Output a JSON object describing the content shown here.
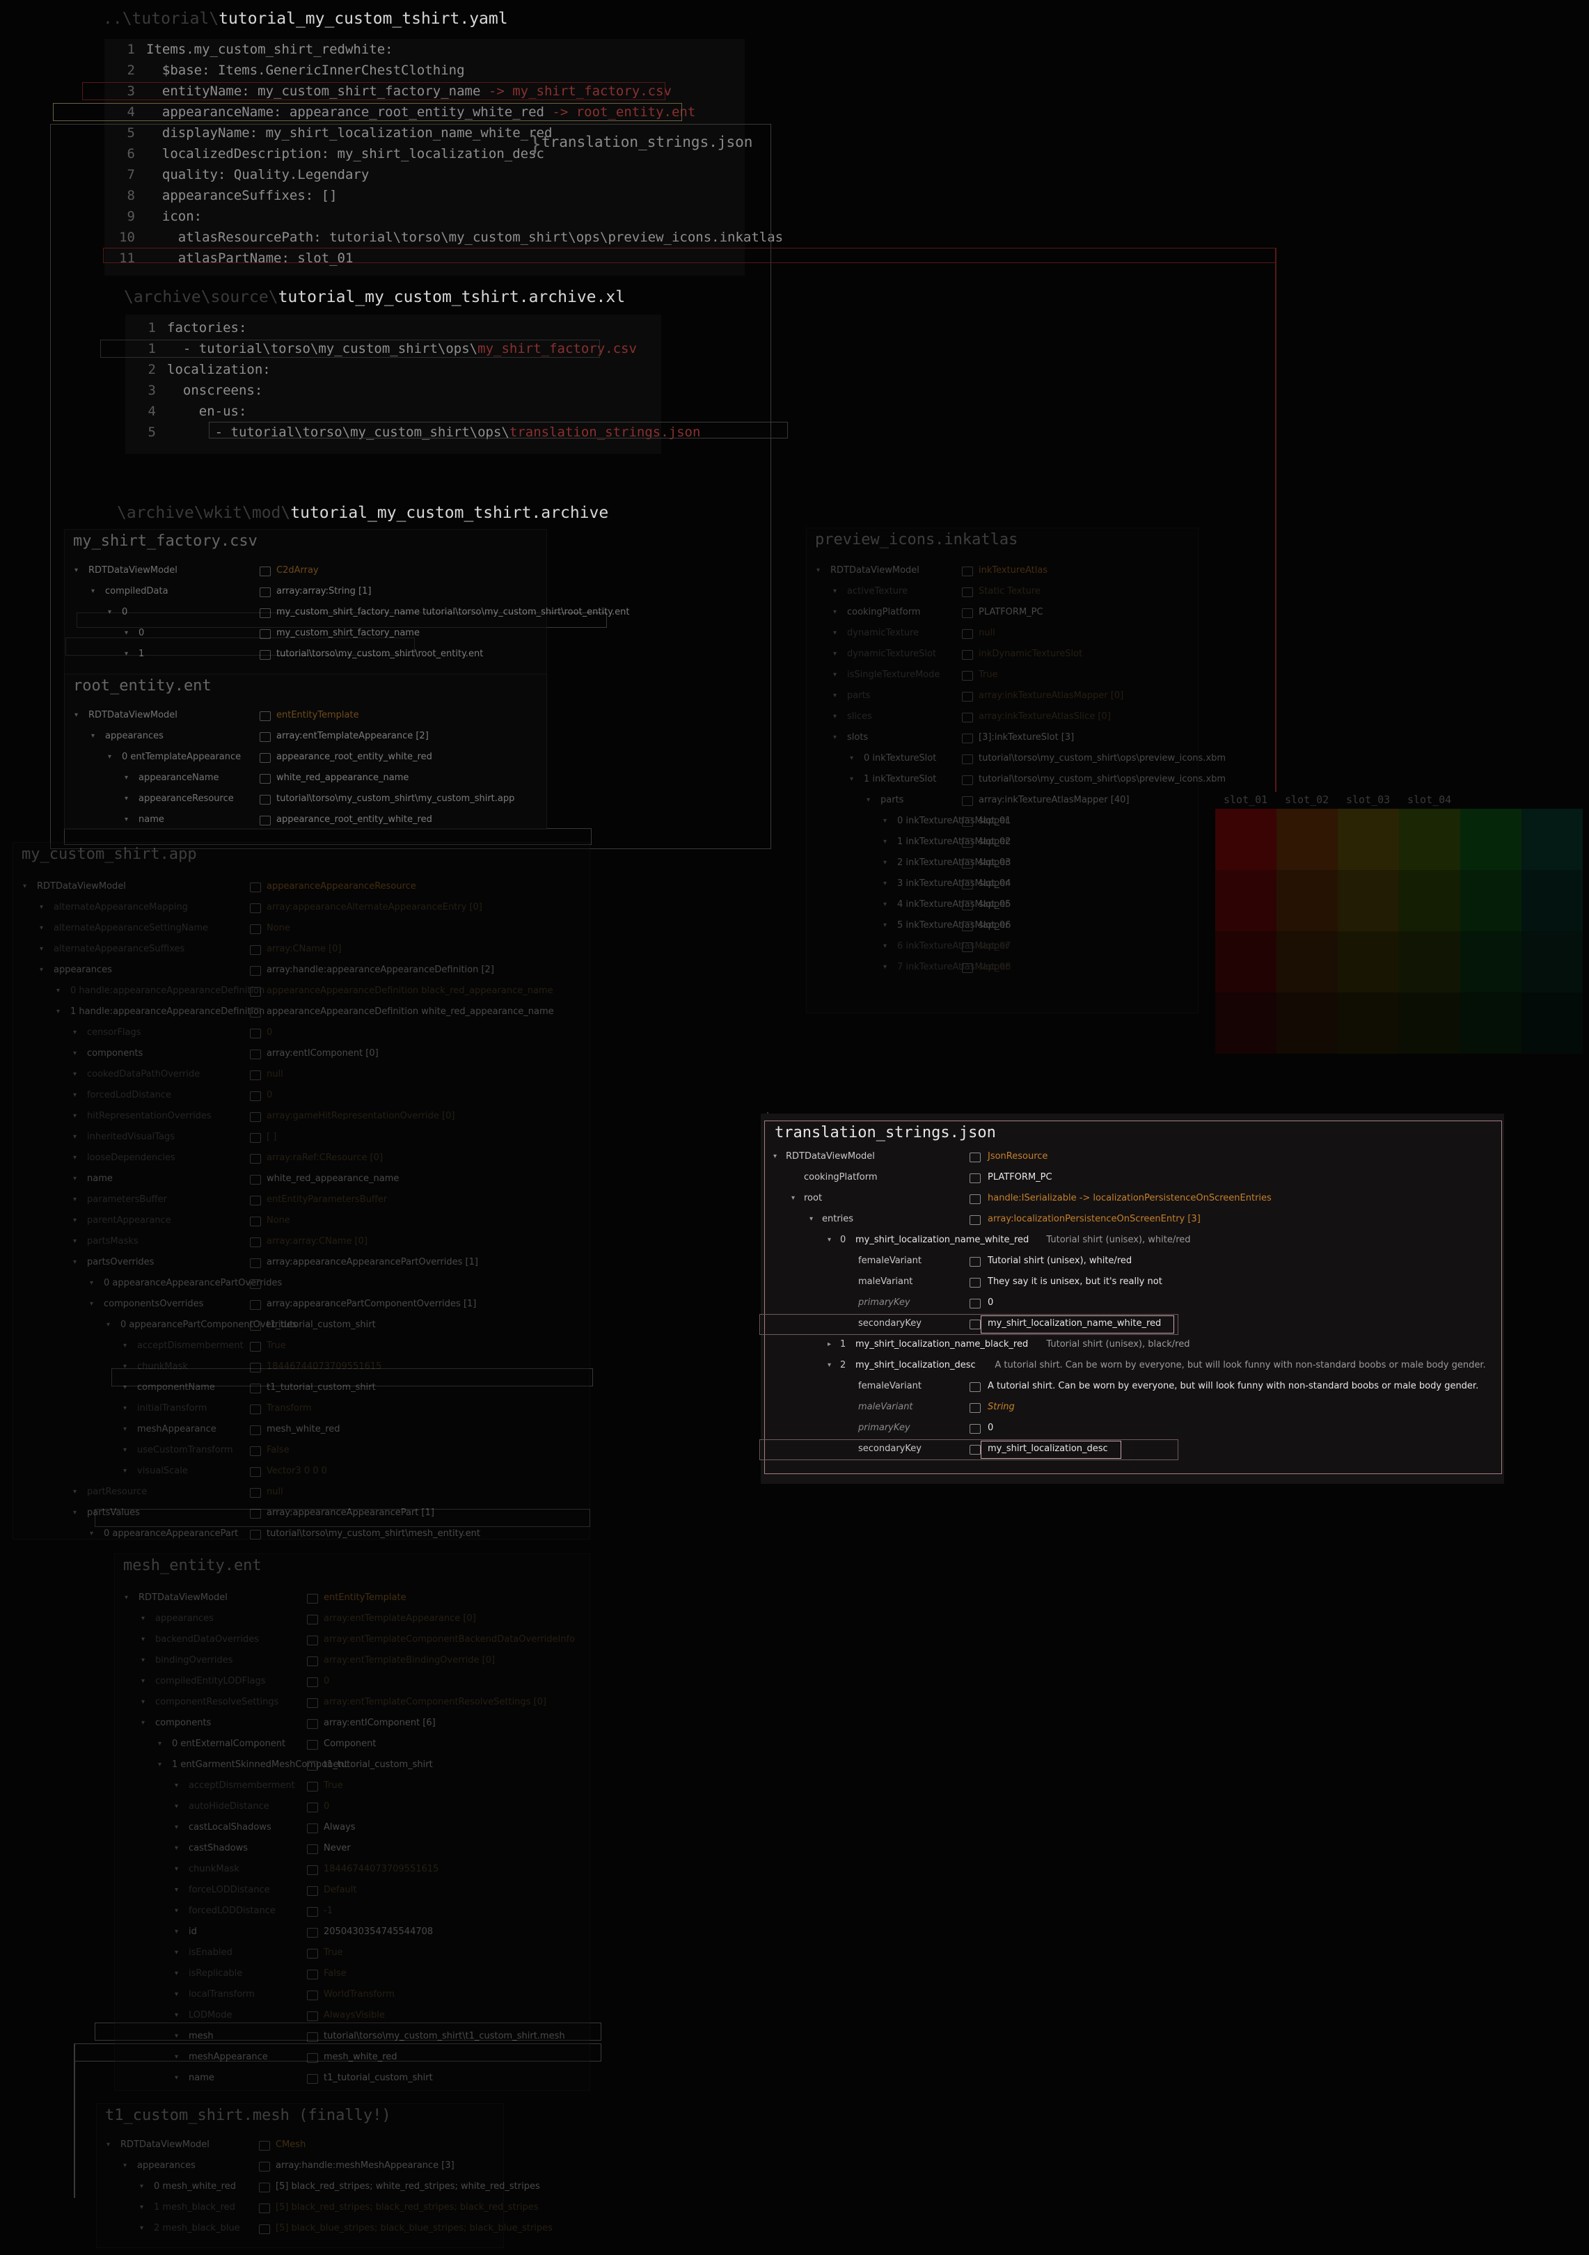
{
  "yaml": {
    "path": "..\\tutorial\\",
    "title": "tutorial_my_custom_tshirt.yaml",
    "lines": [
      {
        "n": "1",
        "t": "Items.my_custom_shirt_redwhite:"
      },
      {
        "n": "2",
        "t": "  $base: Items.GenericInnerChestClothing"
      },
      {
        "n": "3",
        "t": "  entityName: my_custom_shirt_factory_name ",
        "h": "-> my_shirt_factory.csv"
      },
      {
        "n": "4",
        "t": "  appearanceName: appearance_root_entity_white_red ",
        "h": "-> root_entity.ent"
      },
      {
        "n": "5",
        "t": "  displayName: my_shirt_localization_name_white_red"
      },
      {
        "n": "6",
        "t": "  localizedDescription: my_shirt_localization_desc"
      },
      {
        "n": "7",
        "t": "  quality: Quality.Legendary"
      },
      {
        "n": "8",
        "t": "  appearanceSuffixes: []"
      },
      {
        "n": "9",
        "t": "  icon:"
      },
      {
        "n": "10",
        "t": "    atlasResourcePath: tutorial\\torso\\my_custom_shirt\\ops\\preview_icons.inkatlas"
      },
      {
        "n": "11",
        "t": "    atlasPartName: slot_01"
      }
    ],
    "bracket_label": "translation_strings.json"
  },
  "xl": {
    "path": "\\archive\\source\\",
    "title": "tutorial_my_custom_tshirt.archive.xl",
    "lines": [
      {
        "n": "1",
        "t": "factories:"
      },
      {
        "n": "1",
        "t": "  - tutorial\\torso\\my_custom_shirt\\ops\\",
        "h": "my_shirt_factory.csv"
      },
      {
        "n": "2",
        "t": "localization:"
      },
      {
        "n": "3",
        "t": "  onscreens:"
      },
      {
        "n": "4",
        "t": "    en-us:"
      },
      {
        "n": "5",
        "t": "      - tutorial\\torso\\my_custom_shirt\\ops\\",
        "h": "translation_strings.json"
      }
    ]
  },
  "archive": {
    "path": "\\archive\\wkit\\mod\\",
    "title": "tutorial_my_custom_tshirt.archive"
  },
  "factory": {
    "title": "my_shirt_factory.csv",
    "rows": [
      {
        "k": "RDTDataViewModel",
        "v": "C2dArray"
      },
      {
        "k": "compiledData",
        "v": "array:array:String [1]"
      },
      {
        "k": "0",
        "v": "my_custom_shirt_factory_name   tutorial\\torso\\my_custom_shirt\\root_entity.ent"
      },
      {
        "k": "0",
        "v": "my_custom_shirt_factory_name"
      },
      {
        "k": "1",
        "v": "tutorial\\torso\\my_custom_shirt\\root_entity.ent"
      }
    ]
  },
  "root": {
    "title": "root_entity.ent",
    "rows": [
      {
        "k": "RDTDataViewModel",
        "v": "entEntityTemplate"
      },
      {
        "k": "appearances",
        "v": "array:entTemplateAppearance [2]"
      },
      {
        "k": "0  entTemplateAppearance",
        "v": "appearance_root_entity_white_red"
      },
      {
        "k": "appearanceName",
        "v": "white_red_appearance_name"
      },
      {
        "k": "appearanceResource",
        "v": "tutorial\\torso\\my_custom_shirt\\my_custom_shirt.app"
      },
      {
        "k": "name",
        "v": "appearance_root_entity_white_red"
      }
    ]
  },
  "app": {
    "title": "my_custom_shirt.app",
    "rows": [
      {
        "k": "RDTDataViewModel",
        "v": "appearanceAppearanceResource"
      },
      {
        "k": "alternateAppearanceMapping",
        "v": "array:appearanceAlternateAppearanceEntry [0]"
      },
      {
        "k": "alternateAppearanceSettingName",
        "v": "None"
      },
      {
        "k": "alternateAppearanceSuffixes",
        "v": "array:CName [0]"
      },
      {
        "k": "appearances",
        "v": "array:handle:appearanceAppearanceDefinition [2]"
      },
      {
        "k": "0  handle:appearanceAppearanceDefinition",
        "v": "appearanceAppearanceDefinition  black_red_appearance_name"
      },
      {
        "k": "1  handle:appearanceAppearanceDefinition",
        "v": "appearanceAppearanceDefinition  white_red_appearance_name"
      },
      {
        "k": "censorFlags",
        "v": "0"
      },
      {
        "k": "components",
        "v": "array:entIComponent [0]"
      },
      {
        "k": "cookedDataPathOverride",
        "v": "null"
      },
      {
        "k": "forcedLodDistance",
        "v": "0"
      },
      {
        "k": "hitRepresentationOverrides",
        "v": "array:gameHitRepresentationOverride [0]"
      },
      {
        "k": "inheritedVisualTags",
        "v": "[ ]"
      },
      {
        "k": "looseDependencies",
        "v": "array:raRef:CResource [0]"
      },
      {
        "k": "name",
        "v": "white_red_appearance_name"
      },
      {
        "k": "parametersBuffer",
        "v": "entEntityParametersBuffer"
      },
      {
        "k": "parentAppearance",
        "v": "None"
      },
      {
        "k": "partsMasks",
        "v": "array:array:CName [0]"
      },
      {
        "k": "partsOverrides",
        "v": "array:appearanceAppearancePartOverrides [1]"
      },
      {
        "k": "0  appearanceAppearancePartOverrides",
        "v": ""
      },
      {
        "k": "componentsOverrides",
        "v": "array:appearancePartComponentOverrides [1]"
      },
      {
        "k": "0  appearancePartComponentOverrides",
        "v": "t1_tutorial_custom_shirt"
      },
      {
        "k": "acceptDismemberment",
        "v": "True"
      },
      {
        "k": "chunkMask",
        "v": "18446744073709551615"
      },
      {
        "k": "componentName",
        "v": "t1_tutorial_custom_shirt"
      },
      {
        "k": "initialTransform",
        "v": "Transform"
      },
      {
        "k": "meshAppearance",
        "v": "mesh_white_red"
      },
      {
        "k": "useCustomTransform",
        "v": "False"
      },
      {
        "k": "visualScale",
        "v": "Vector3 0 0 0"
      },
      {
        "k": "partResource",
        "v": "null"
      },
      {
        "k": "partsValues",
        "v": "array:appearanceAppearancePart [1]"
      },
      {
        "k": "0  appearanceAppearancePart",
        "v": "tutorial\\torso\\my_custom_shirt\\mesh_entity.ent"
      }
    ]
  },
  "mesh_entity": {
    "title": "mesh_entity.ent",
    "rows": [
      {
        "k": "RDTDataViewModel",
        "v": "entEntityTemplate"
      },
      {
        "k": "appearances",
        "v": "array:entTemplateAppearance [0]"
      },
      {
        "k": "backendDataOverrides",
        "v": "array:entTemplateComponentBackendDataOverrideInfo"
      },
      {
        "k": "bindingOverrides",
        "v": "array:entTemplateBindingOverride [0]"
      },
      {
        "k": "compiledEntityLODFlags",
        "v": "0"
      },
      {
        "k": "componentResolveSettings",
        "v": "array:entTemplateComponentResolveSettings [0]"
      },
      {
        "k": "components",
        "v": "array:entIComponent [6]"
      },
      {
        "k": "0  entExternalComponent",
        "v": "Component"
      },
      {
        "k": "1  entGarmentSkinnedMeshComponent",
        "v": "t1_tutorial_custom_shirt"
      },
      {
        "k": "acceptDismemberment",
        "v": "True"
      },
      {
        "k": "autoHideDistance",
        "v": "0"
      },
      {
        "k": "castLocalShadows",
        "v": "Always"
      },
      {
        "k": "castShadows",
        "v": "Never"
      },
      {
        "k": "chunkMask",
        "v": "18446744073709551615"
      },
      {
        "k": "forceLODDistance",
        "v": "Default"
      },
      {
        "k": "forcedLODDistance",
        "v": "-1"
      },
      {
        "k": "id",
        "v": "2050430354745544708"
      },
      {
        "k": "isEnabled",
        "v": "True"
      },
      {
        "k": "isReplicable",
        "v": "False"
      },
      {
        "k": "localTransform",
        "v": "WorldTransform"
      },
      {
        "k": "LODMode",
        "v": "AlwaysVisible"
      },
      {
        "k": "mesh",
        "v": "tutorial\\torso\\my_custom_shirt\\t1_custom_shirt.mesh"
      },
      {
        "k": "meshAppearance",
        "v": "mesh_white_red"
      },
      {
        "k": "name",
        "v": "t1_tutorial_custom_shirt"
      }
    ]
  },
  "mesh": {
    "title": "t1_custom_shirt.mesh (finally!)",
    "rows": [
      {
        "k": "RDTDataViewModel",
        "v": "CMesh"
      },
      {
        "k": "appearances",
        "v": "array:handle:meshMeshAppearance [3]"
      },
      {
        "k": "0  mesh_white_red",
        "v": "[5] black_red_stripes; white_red_stripes; white_red_stripes"
      },
      {
        "k": "1  mesh_black_red",
        "v": "[5] black_red_stripes; black_red_stripes; black_red_stripes"
      },
      {
        "k": "2  mesh_black_blue",
        "v": "[5] black_blue_stripes; black_blue_stripes; black_blue_stripes"
      }
    ]
  },
  "atlas": {
    "title": "preview_icons.inkatlas",
    "rows": [
      {
        "k": "RDTDataViewModel",
        "v": "inkTextureAtlas"
      },
      {
        "k": "activeTexture",
        "v": "Static Texture"
      },
      {
        "k": "cookingPlatform",
        "v": "PLATFORM_PC"
      },
      {
        "k": "dynamicTexture",
        "v": "null"
      },
      {
        "k": "dynamicTextureSlot",
        "v": "inkDynamicTextureSlot"
      },
      {
        "k": "isSingleTextureMode",
        "v": "True"
      },
      {
        "k": "parts",
        "v": "array:inkTextureAtlasMapper [0]"
      },
      {
        "k": "slices",
        "v": "array:inkTextureAtlasSlice [0]"
      },
      {
        "k": "slots",
        "v": "[3]:inkTextureSlot [3]"
      },
      {
        "k": "0  inkTextureSlot",
        "v": "tutorial\\torso\\my_custom_shirt\\ops\\preview_icons.xbm"
      },
      {
        "k": "1  inkTextureSlot",
        "v": "tutorial\\torso\\my_custom_shirt\\ops\\preview_icons.xbm"
      },
      {
        "k": "parts",
        "v": "array:inkTextureAtlasMapper [40]"
      },
      {
        "k": "0  inkTextureAtlasMapper",
        "v": "slot_01"
      },
      {
        "k": "1  inkTextureAtlasMapper",
        "v": "slot_02"
      },
      {
        "k": "2  inkTextureAtlasMapper",
        "v": "slot_03"
      },
      {
        "k": "3  inkTextureAtlasMapper",
        "v": "slot_04"
      },
      {
        "k": "4  inkTextureAtlasMapper",
        "v": "slot_05"
      },
      {
        "k": "5  inkTextureAtlasMapper",
        "v": "slot_06"
      },
      {
        "k": "6  inkTextureAtlasMapper",
        "v": "slot_07"
      },
      {
        "k": "7  inkTextureAtlasMapper",
        "v": "slot_08"
      }
    ],
    "slot_heads": [
      "slot_01",
      "slot_02",
      "slot_03",
      "slot_04"
    ]
  },
  "translation": {
    "title": "translation_strings.json",
    "rows": [
      {
        "k": "RDTDataViewModel",
        "v": "JsonResource",
        "sub": ""
      },
      {
        "k": "cookingPlatform",
        "v": "PLATFORM_PC",
        "sub": ""
      },
      {
        "k": "root",
        "v": "handle:ISerializable -> localizationPersistenceOnScreenEntries",
        "sub": ""
      },
      {
        "k": "entries",
        "v": "array:localizationPersistenceOnScreenEntry [3]",
        "sub": ""
      },
      {
        "k": "0",
        "v": "my_shirt_localization_name_white_red",
        "sub": "Tutorial shirt (unisex), white/red"
      },
      {
        "k": "femaleVariant",
        "v": "Tutorial shirt (unisex), white/red",
        "sub": ""
      },
      {
        "k": "maleVariant",
        "v": "They say it is unisex, but it's really not",
        "sub": ""
      },
      {
        "k": "primaryKey",
        "v": "0",
        "sub": ""
      },
      {
        "k": "secondaryKey",
        "v": "my_shirt_localization_name_white_red",
        "sub": ""
      },
      {
        "k": "1",
        "v": "my_shirt_localization_name_black_red",
        "sub": "Tutorial shirt (unisex), black/red"
      },
      {
        "k": "2",
        "v": "my_shirt_localization_desc",
        "sub": "A tutorial shirt. Can be worn by everyone, but will look funny with non-standard boobs or male body gender."
      },
      {
        "k": "femaleVariant",
        "v": "A tutorial shirt. Can be worn by everyone, but will look funny with non-standard boobs or male body gender.",
        "sub": ""
      },
      {
        "k": "maleVariant",
        "v": "String",
        "sub": ""
      },
      {
        "k": "primaryKey",
        "v": "0",
        "sub": ""
      },
      {
        "k": "secondaryKey",
        "v": "my_shirt_localization_desc",
        "sub": ""
      }
    ]
  },
  "colors": {
    "accent_red": "#5a1717",
    "accent_gold": "#6b6142",
    "type_orange": "#c4802c",
    "highlight": "#c9a9ae"
  }
}
